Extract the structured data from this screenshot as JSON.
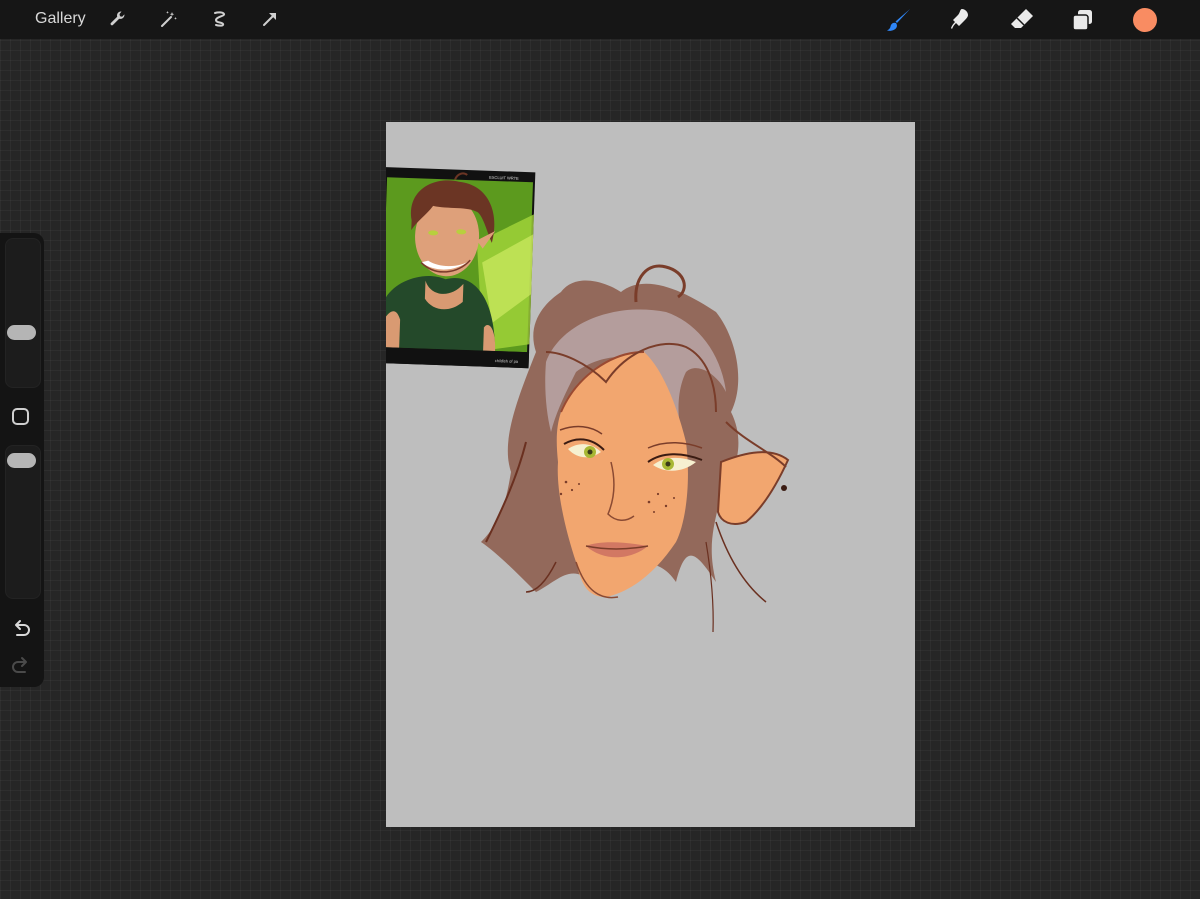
{
  "topbar": {
    "gallery_label": "Gallery",
    "actions": [
      {
        "icon": "wrench-icon"
      },
      {
        "icon": "magic-wand-icon"
      },
      {
        "icon": "selection-icon"
      },
      {
        "icon": "transform-arrow-icon"
      }
    ],
    "tools": [
      {
        "icon": "brush-icon",
        "active": true
      },
      {
        "icon": "smudge-icon",
        "active": false
      },
      {
        "icon": "eraser-icon",
        "active": false
      },
      {
        "icon": "layers-icon",
        "active": false
      }
    ],
    "current_color": "#f98c62"
  },
  "sidebar": {
    "brush_size_level": 0.62,
    "opacity_level": 0.95,
    "buttons": [
      "undo-icon",
      "redo-icon"
    ]
  },
  "reference_image": {
    "header_text": "EXCLUIT WRTE",
    "footer_text": "childish of pa"
  },
  "colors": {
    "accent_blue": "#2f86f6",
    "canvas_bg": "#bebebe",
    "skin": "#f2a66f",
    "hair": "#7a3d2a"
  }
}
